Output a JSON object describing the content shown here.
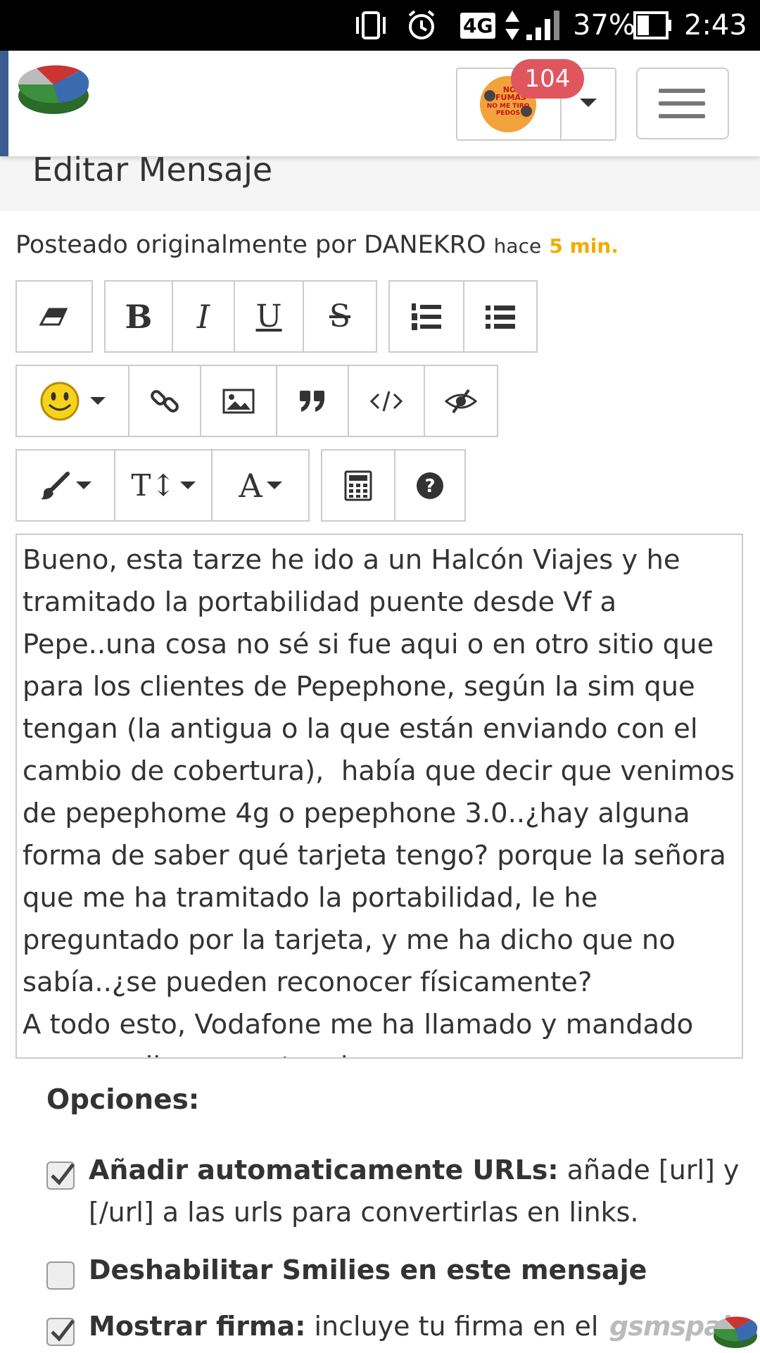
{
  "status_bar": {
    "network": "4G",
    "battery": "37%",
    "time": "2:43"
  },
  "header": {
    "notification_count": "104",
    "avatar_text_1": "NO FUMAS",
    "avatar_text_2": "NO ME TIRO PEDOS"
  },
  "page": {
    "title": "Editar Mensaje",
    "posted_prefix": "Posteado originalmente por DANEKRO",
    "posted_hace": "hace",
    "posted_time": "5 min."
  },
  "editor": {
    "content": "Bueno, esta tarze he ido a un Halcón Viajes y he tramitado la portabilidad puente desde Vf a Pepe..una cosa no sé si fue aqui o en otro sitio que para los clientes de Pepephone, según la sim que tengan (la antigua o la que están enviando con el cambio de cobertura),  había que decir que venimos de pepephome 4g o pepephone 3.0..¿hay alguna forma de saber qué tarjeta tengo? porque la señora que me ha tramitado la portabilidad, le he preguntado por la tarjeta, y me ha dicho que no sabía..¿se pueden reconocer físicamente?\nA todo esto, Vodafone me ha llamado y mandado sms que llame a retenciones, para o..."
  },
  "options": {
    "title": "Opciones:",
    "items": [
      {
        "label": "Añadir automaticamente URLs:",
        "desc": " añade [url] y [/url] a las urls para convertirlas en links.",
        "checked": true
      },
      {
        "label": "Deshabilitar Smilies en este mensaje",
        "desc": "",
        "checked": false
      },
      {
        "label": "Mostrar firma:",
        "desc": " incluye tu firma en el",
        "checked": true
      }
    ]
  },
  "watermark": {
    "text": "gsmspain"
  },
  "colors": {
    "accent_time": "#f0ad00",
    "badge": "#e0565f",
    "header_left_bar": "#3b5d8f"
  },
  "icons": {
    "toolbar_row1": [
      "eraser-icon",
      "bold-icon",
      "italic-icon",
      "underline-icon",
      "strikethrough-icon",
      "ordered-list-icon",
      "unordered-list-icon"
    ],
    "toolbar_row2": [
      "smiley-icon",
      "link-icon",
      "image-icon",
      "quote-icon",
      "code-icon",
      "hide-icon"
    ],
    "toolbar_row3": [
      "brush-icon",
      "font-size-icon",
      "font-color-icon",
      "calculator-icon",
      "help-icon"
    ]
  }
}
